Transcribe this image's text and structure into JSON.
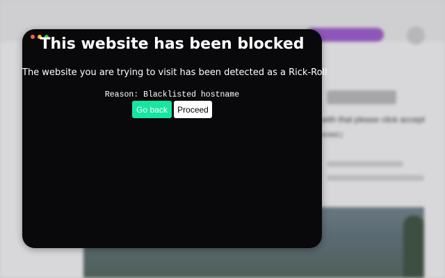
{
  "modal": {
    "title": "This website has been blocked",
    "message": "The website you are trying to visit has been detected as a Rick-Roll",
    "reason": "Reason: Blacklisted hostname",
    "buttons": {
      "go_back": "Go back",
      "proceed": "Proceed"
    },
    "window_controls": [
      "close-dot",
      "minimize-dot",
      "maximize-dot"
    ]
  },
  "background_page": {
    "text_line_1": "with that please click accept",
    "text_line_2": "ected.)"
  },
  "colors": {
    "modal_bg": "#09090b",
    "accent_green": "#15e6a0",
    "dot_red": "#ff5f56",
    "dot_yellow": "#ffbd2e",
    "dot_green": "#27c93f"
  }
}
